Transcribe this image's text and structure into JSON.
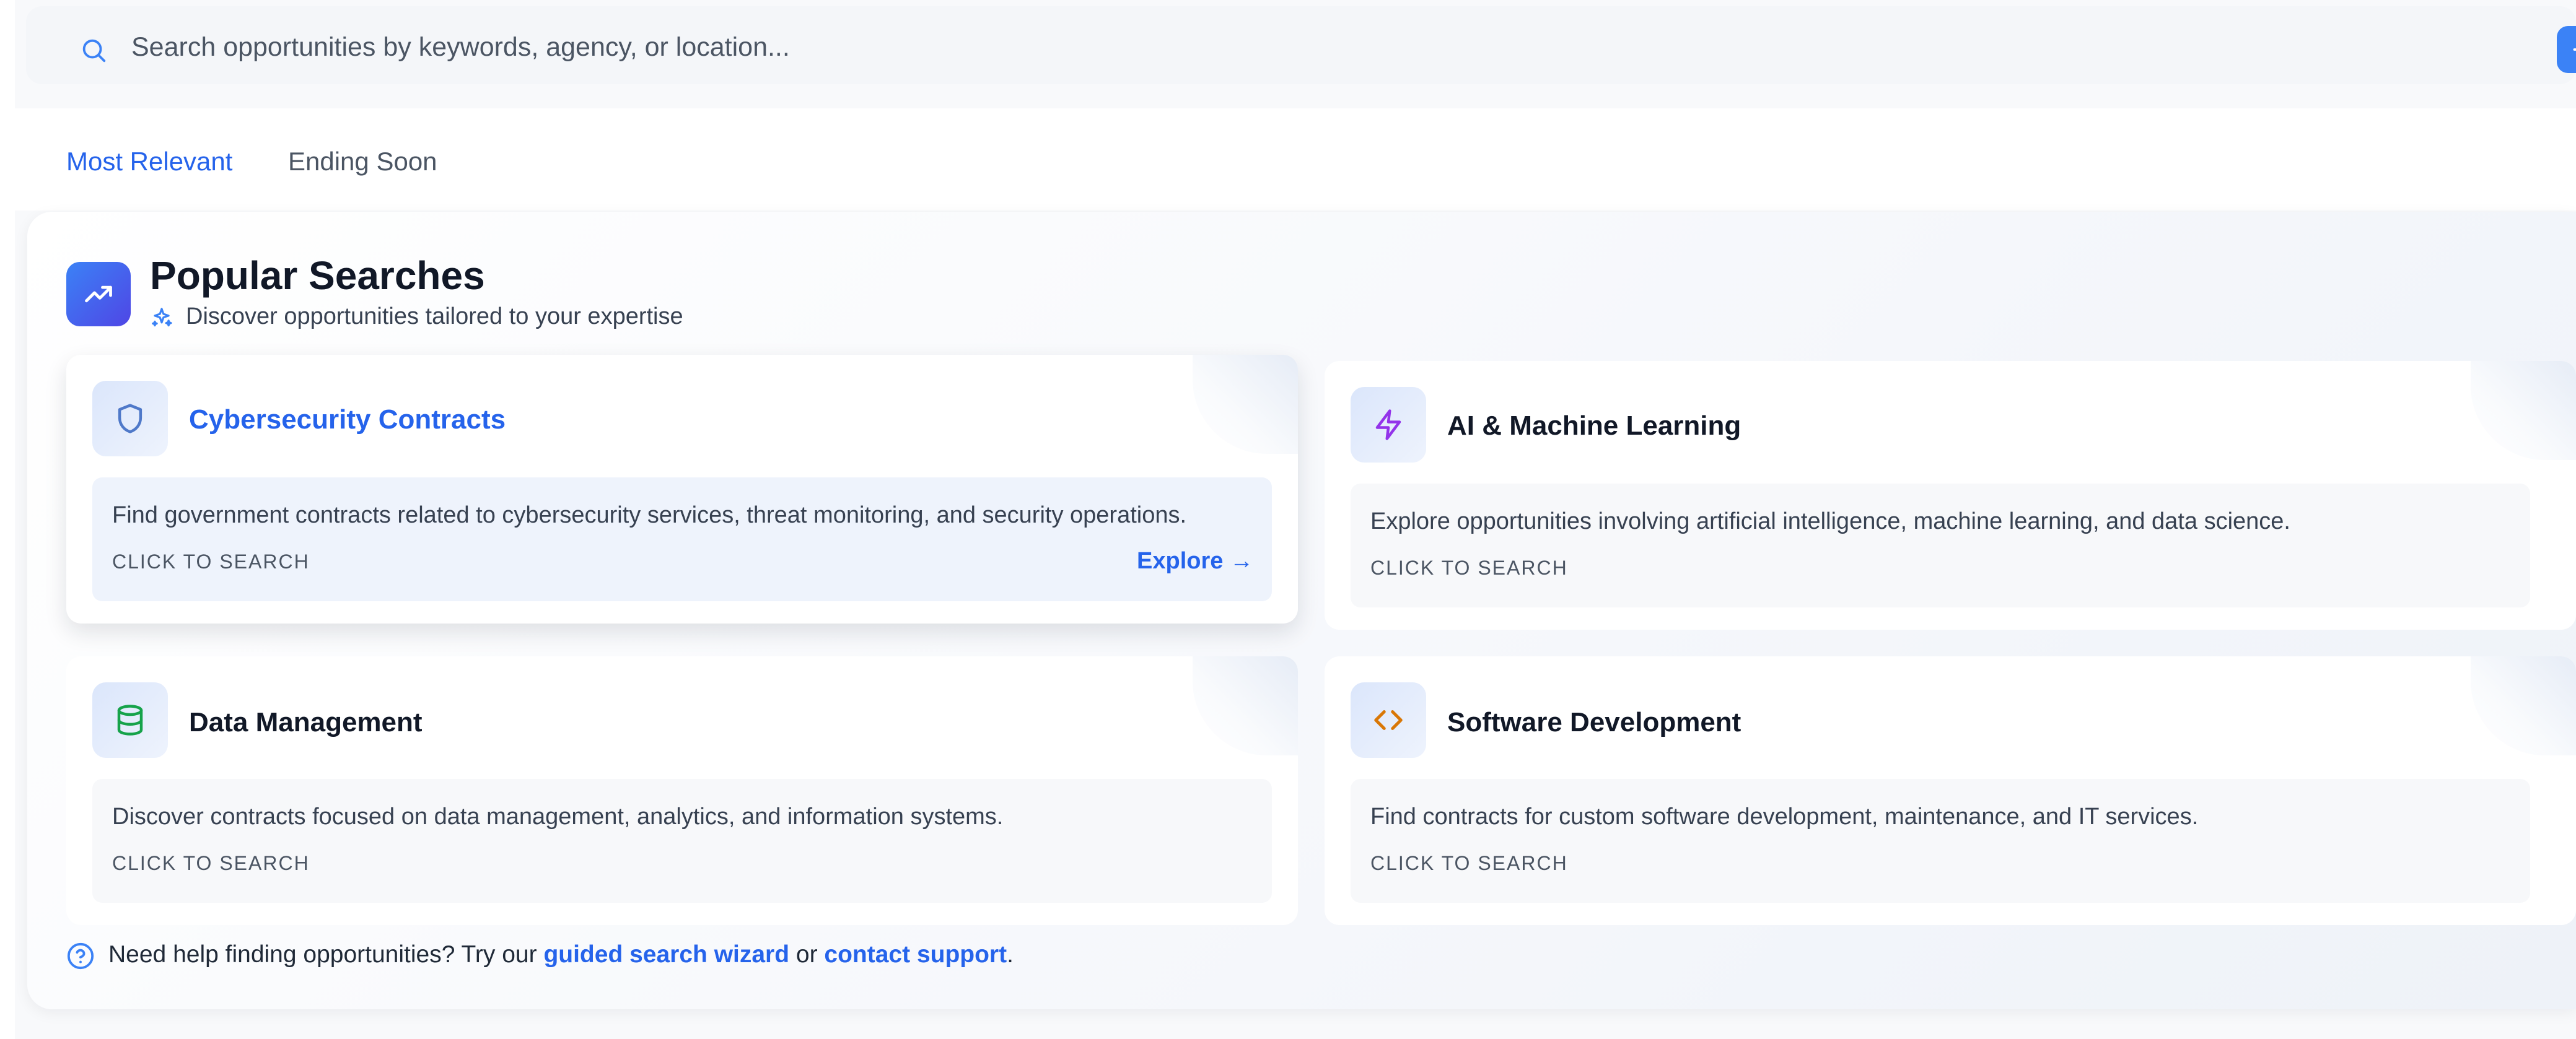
{
  "search": {
    "placeholder": "Search opportunities by keywords, agency, or location...",
    "value": "",
    "icon": "search-icon",
    "submit_icon": "arrow-right-icon"
  },
  "tabs": [
    {
      "label": "Most Relevant",
      "active": true
    },
    {
      "label": "Ending Soon",
      "active": false
    }
  ],
  "popular": {
    "title": "Popular Searches",
    "subtitle": "Discover opportunities tailored to your expertise",
    "icon": "trending-up-icon",
    "subtitle_icon": "sparkles-icon"
  },
  "cards": [
    {
      "title": "Cybersecurity Contracts",
      "description": "Find government contracts related to cybersecurity services, threat monitoring, and security operations.",
      "cta": "CLICK TO SEARCH",
      "explore": "Explore →",
      "icon": "shield-icon",
      "icon_color": "#4f79c9",
      "active": true
    },
    {
      "title": "AI & Machine Learning",
      "description": "Explore opportunities involving artificial intelligence, machine learning, and data science.",
      "cta": "CLICK TO SEARCH",
      "icon": "zap-icon",
      "icon_color": "#9333ea",
      "active": false
    },
    {
      "title": "Data Management",
      "description": "Discover contracts focused on data management, analytics, and information systems.",
      "cta": "CLICK TO SEARCH",
      "icon": "database-icon",
      "icon_color": "#16a34a",
      "active": false
    },
    {
      "title": "Software Development",
      "description": "Find contracts for custom software development, maintenance, and IT services.",
      "cta": "CLICK TO SEARCH",
      "icon": "code-icon",
      "icon_color": "#d97706",
      "active": false
    }
  ],
  "help": {
    "icon": "help-circle-icon",
    "text_before": "Need help finding opportunities? Try our ",
    "link1": "guided search wizard",
    "text_mid": " or ",
    "link2": "contact support",
    "text_after": "."
  },
  "colors": {
    "accent": "#2563eb",
    "button": "#3b82f6"
  }
}
